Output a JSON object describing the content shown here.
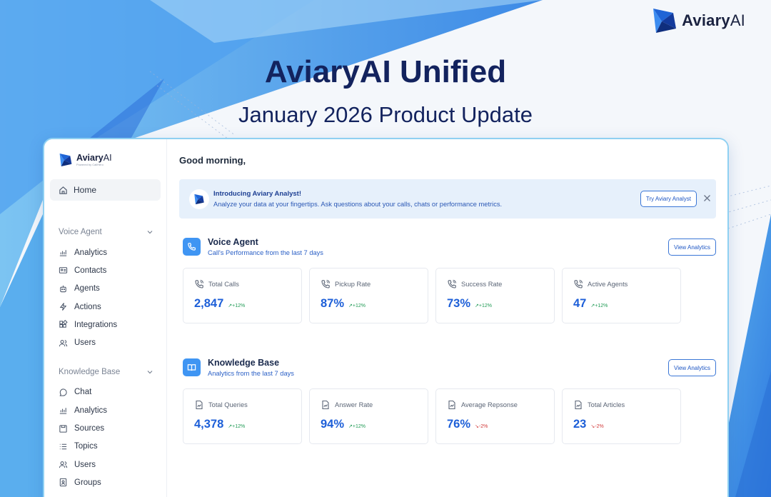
{
  "brand": {
    "name_main": "Aviary",
    "name_suffix": "AI",
    "powered_by": "Powered by CallHero"
  },
  "hero": {
    "title": "AviaryAI Unified",
    "subtitle": "January 2026 Product Update"
  },
  "colors": {
    "brand_blue": "#1d5fd8",
    "navy": "#13235e",
    "accent_cyan": "#8fd0f2",
    "positive": "#1f9a54",
    "negative": "#d23a3a"
  },
  "sidebar": {
    "home": {
      "label": "Home",
      "icon": "home-icon"
    },
    "sections": [
      {
        "title": "Voice Agent",
        "items": [
          {
            "label": "Analytics",
            "icon": "chart-icon"
          },
          {
            "label": "Contacts",
            "icon": "contact-card-icon"
          },
          {
            "label": "Agents",
            "icon": "robot-icon"
          },
          {
            "label": "Actions",
            "icon": "lightning-icon"
          },
          {
            "label": "Integrations",
            "icon": "blocks-icon"
          },
          {
            "label": "Users",
            "icon": "users-icon"
          }
        ]
      },
      {
        "title": "Knowledge Base",
        "items": [
          {
            "label": "Chat",
            "icon": "chat-bubble-icon"
          },
          {
            "label": "Analytics",
            "icon": "chart-icon"
          },
          {
            "label": "Sources",
            "icon": "save-icon"
          },
          {
            "label": "Topics",
            "icon": "list-icon"
          },
          {
            "label": "Users",
            "icon": "users-icon"
          },
          {
            "label": "Groups",
            "icon": "id-badge-icon"
          }
        ]
      }
    ]
  },
  "main": {
    "greeting": "Good morning,",
    "banner": {
      "title": "Introducing Aviary Analyst!",
      "description": "Analyze your data at your fingertips. Ask questions about your calls, chats or performance metrics.",
      "button": "Try Aviary Analyst"
    },
    "voice_agent": {
      "title": "Voice Agent",
      "subtitle": "Call's Performance from the last 7 days",
      "button": "View Analytics",
      "stats": [
        {
          "label": "Total Calls",
          "value": "2,847",
          "delta": "+12%",
          "trend": "up"
        },
        {
          "label": "Pickup Rate",
          "value": "87%",
          "delta": "+12%",
          "trend": "up"
        },
        {
          "label": "Success Rate",
          "value": "73%",
          "delta": "+12%",
          "trend": "up"
        },
        {
          "label": "Active Agents",
          "value": "47",
          "delta": "+12%",
          "trend": "up"
        }
      ]
    },
    "knowledge_base": {
      "title": "Knowledge Base",
      "subtitle": "Analytics from the last 7 days",
      "button": "View Analytics",
      "stats": [
        {
          "label": "Total Queries",
          "value": "4,378",
          "delta": "+12%",
          "trend": "up"
        },
        {
          "label": "Answer Rate",
          "value": "94%",
          "delta": "+12%",
          "trend": "up"
        },
        {
          "label": "Average Repsonse",
          "value": "76%",
          "delta": "-2%",
          "trend": "down"
        },
        {
          "label": "Total Articles",
          "value": "23",
          "delta": "-2%",
          "trend": "down"
        }
      ]
    }
  }
}
